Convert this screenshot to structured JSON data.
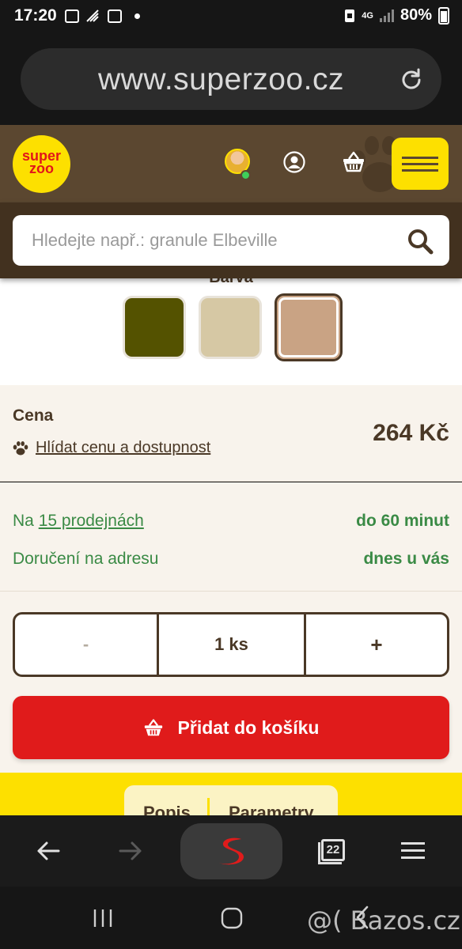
{
  "status_bar": {
    "time": "17:20",
    "network": "4G",
    "battery": "80%"
  },
  "browser": {
    "url": "www.superzoo.cz"
  },
  "header": {
    "logo_line1": "super",
    "logo_line2": "zoo"
  },
  "search": {
    "placeholder": "Hledejte např.: granule Elbeville"
  },
  "product": {
    "color_label": "Barva",
    "colors": [
      "#545200",
      "#d6c8a4",
      "#c9a384"
    ],
    "selected_color_index": 2
  },
  "price": {
    "label": "Cena",
    "watch_link": "Hlídat cenu a dostupnost",
    "value": "264 Kč"
  },
  "availability": {
    "stores_prefix": "Na",
    "stores_link": "15 prodejnách",
    "stores_time": "do 60 minut",
    "delivery_label": "Doručení na adresu",
    "delivery_time": "dnes u vás"
  },
  "quantity": {
    "minus": "-",
    "value": "1 ks",
    "plus": "+"
  },
  "cart": {
    "add_label": "Přidat do košíku"
  },
  "tabs": {
    "description": "Popis",
    "parameters": "Parametry"
  },
  "bottom_nav": {
    "tab_count": "22"
  },
  "watermark": "@( Bazos.cz",
  "colors": {
    "header_brown": "#5b4730",
    "search_bar_brown": "#42311f",
    "brand_yellow": "#fde000",
    "brand_red": "#e01b1b",
    "text_brown": "#4a3826",
    "availability_green": "#3a8a45",
    "panel_beige": "#f8f3ec"
  }
}
